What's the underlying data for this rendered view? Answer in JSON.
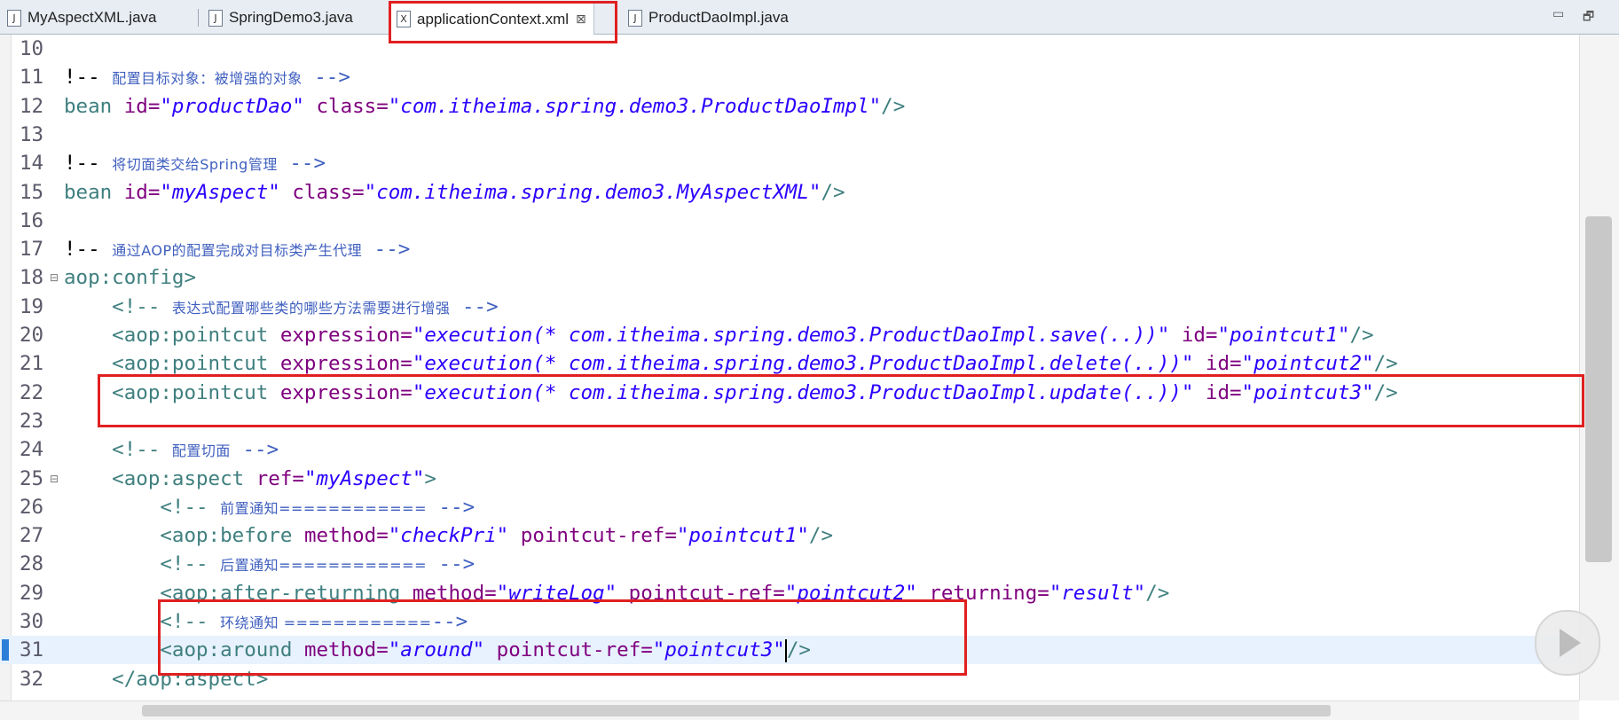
{
  "tabs": [
    {
      "label": "MyAspectXML.java",
      "icon": "java-file-icon",
      "icon_glyph": "J"
    },
    {
      "label": "SpringDemo3.java",
      "icon": "java-file-icon",
      "icon_glyph": "J"
    },
    {
      "label": "applicationContext.xml",
      "icon": "xml-file-icon",
      "icon_glyph": "X",
      "active": true
    },
    {
      "label": "ProductDaoImpl.java",
      "icon": "java-file-icon",
      "icon_glyph": "J"
    }
  ],
  "tab_close_glyph": "⊠",
  "window_buttons": {
    "minimize": "▭",
    "maximize": "🗗"
  },
  "highlight_color": "#e02020",
  "lines": [
    {
      "n": "10",
      "segs": []
    },
    {
      "n": "11",
      "segs": [
        [
          "pl",
          "!-- "
        ],
        [
          "cm",
          "配置目标对象：被增强的对象"
        ],
        [
          "cmd",
          " -->"
        ]
      ]
    },
    {
      "n": "12",
      "segs": [
        [
          "tag",
          "bean "
        ],
        [
          "attr",
          "id="
        ],
        [
          "str",
          "\"productDao\""
        ],
        [
          "attr",
          " class="
        ],
        [
          "str",
          "\"com.itheima.spring.demo3.ProductDaoImpl\""
        ],
        [
          "tag",
          "/>"
        ]
      ]
    },
    {
      "n": "13",
      "segs": []
    },
    {
      "n": "14",
      "segs": [
        [
          "pl",
          "!-- "
        ],
        [
          "cm",
          "将切面类交给Spring管理"
        ],
        [
          "cmd",
          " -->"
        ]
      ]
    },
    {
      "n": "15",
      "segs": [
        [
          "tag",
          "bean "
        ],
        [
          "attr",
          "id="
        ],
        [
          "str",
          "\"myAspect\""
        ],
        [
          "attr",
          " class="
        ],
        [
          "str",
          "\"com.itheima.spring.demo3.MyAspectXML\""
        ],
        [
          "tag",
          "/>"
        ]
      ]
    },
    {
      "n": "16",
      "segs": []
    },
    {
      "n": "17",
      "segs": [
        [
          "pl",
          "!-- "
        ],
        [
          "cm",
          "通过AOP的配置完成对目标类产生代理"
        ],
        [
          "cmd",
          " -->"
        ]
      ]
    },
    {
      "n": "18",
      "fold": true,
      "segs": [
        [
          "tag",
          "aop:config>"
        ]
      ]
    },
    {
      "n": "19",
      "segs": [
        [
          "tag",
          "    <!-- "
        ],
        [
          "cm",
          "表达式配置哪些类的哪些方法需要进行增强"
        ],
        [
          "cmd",
          " -->"
        ]
      ]
    },
    {
      "n": "20",
      "segs": [
        [
          "tag",
          "    <aop:pointcut "
        ],
        [
          "attr",
          "expression="
        ],
        [
          "str",
          "\"execution(* com.itheima.spring.demo3.ProductDaoImpl.save(..))\""
        ],
        [
          "attr",
          " id="
        ],
        [
          "str",
          "\"pointcut1\""
        ],
        [
          "tag",
          "/>"
        ]
      ]
    },
    {
      "n": "21",
      "segs": [
        [
          "tag",
          "    <aop:pointcut "
        ],
        [
          "attr",
          "expression="
        ],
        [
          "str",
          "\"execution(* com.itheima.spring.demo3.ProductDaoImpl.delete(..))\""
        ],
        [
          "attr",
          " id="
        ],
        [
          "str",
          "\"pointcut2\""
        ],
        [
          "tag",
          "/>"
        ]
      ]
    },
    {
      "n": "22",
      "segs": [
        [
          "tag",
          "    <aop:pointcut "
        ],
        [
          "attr",
          "expression="
        ],
        [
          "str",
          "\"execution(* com.itheima.spring.demo3.ProductDaoImpl.update(..))\""
        ],
        [
          "attr",
          " id="
        ],
        [
          "str",
          "\"pointcut3\""
        ],
        [
          "tag",
          "/>"
        ]
      ]
    },
    {
      "n": "23",
      "segs": []
    },
    {
      "n": "24",
      "segs": [
        [
          "tag",
          "    <!-- "
        ],
        [
          "cm",
          "配置切面"
        ],
        [
          "cmd",
          " -->"
        ]
      ]
    },
    {
      "n": "25",
      "fold": true,
      "segs": [
        [
          "tag",
          "    <aop:aspect "
        ],
        [
          "attr",
          "ref="
        ],
        [
          "str",
          "\"myAspect\""
        ],
        [
          "tag",
          ">"
        ]
      ]
    },
    {
      "n": "26",
      "segs": [
        [
          "tag",
          "        <!-- "
        ],
        [
          "cm",
          "前置通知============"
        ],
        [
          "cmd",
          " -->"
        ]
      ]
    },
    {
      "n": "27",
      "segs": [
        [
          "tag",
          "        <aop:before "
        ],
        [
          "attr",
          "method="
        ],
        [
          "str",
          "\"checkPri\""
        ],
        [
          "attr",
          " pointcut-ref="
        ],
        [
          "str",
          "\"pointcut1\""
        ],
        [
          "tag",
          "/>"
        ]
      ]
    },
    {
      "n": "28",
      "segs": [
        [
          "tag",
          "        <!-- "
        ],
        [
          "cm",
          "后置通知============"
        ],
        [
          "cmd",
          " -->"
        ]
      ]
    },
    {
      "n": "29",
      "segs": [
        [
          "tag",
          "        <aop:after-returning "
        ],
        [
          "attr",
          "method="
        ],
        [
          "str",
          "\"writeLog\""
        ],
        [
          "attr",
          " pointcut-ref="
        ],
        [
          "str",
          "\"pointcut2\""
        ],
        [
          "attr",
          " returning="
        ],
        [
          "str",
          "\"result\""
        ],
        [
          "tag",
          "/>"
        ]
      ]
    },
    {
      "n": "30",
      "segs": [
        [
          "tag",
          "        <!-- "
        ],
        [
          "cm",
          "环绕通知 ============"
        ],
        [
          "cmd",
          "-->"
        ]
      ]
    },
    {
      "n": "31",
      "current": true,
      "segs": [
        [
          "tag",
          "        <aop:around "
        ],
        [
          "attr",
          "method="
        ],
        [
          "str",
          "\"around\""
        ],
        [
          "attr",
          " pointcut-ref="
        ],
        [
          "str",
          "\"pointcut3\""
        ],
        [
          "tag",
          "/>"
        ]
      ]
    },
    {
      "n": "32",
      "segs": [
        [
          "tag",
          "    </aop:aspect>"
        ]
      ]
    }
  ]
}
